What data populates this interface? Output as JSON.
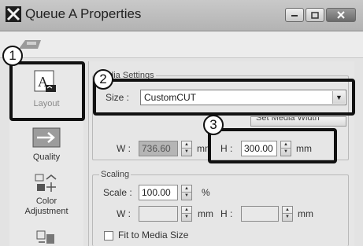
{
  "window": {
    "title": "Queue A Properties",
    "icons": {
      "app": "queue-app-icon",
      "minimize": "minimize-icon",
      "maximize": "maximize-icon",
      "close": "close-icon"
    }
  },
  "callouts": {
    "one": "1",
    "two": "2",
    "three": "3"
  },
  "sidebar": {
    "items": [
      {
        "label": "Layout",
        "icon": "layout-icon",
        "selected": true
      },
      {
        "label": "Quality",
        "icon": "quality-icon"
      },
      {
        "label": "Color Adjustment",
        "line1": "Color",
        "line2": "Adjustment",
        "icon": "color-adjustment-icon"
      },
      {
        "label": "",
        "icon": "filter-icon"
      }
    ]
  },
  "media_settings": {
    "legend_partial": "edia Settings",
    "size_label": "Size :",
    "size_value": "CustomCUT",
    "set_media_button_partial": "Set Media Width",
    "w_label": "W :",
    "w_value": "736.60",
    "w_unit": "mm",
    "h_label": "H :",
    "h_value": "300.00",
    "h_unit": "mm"
  },
  "scaling": {
    "legend": "Scaling",
    "scale_label": "Scale :",
    "scale_value": "100.00",
    "scale_unit": "%",
    "w_label": "W :",
    "w_unit": "mm",
    "h_label": "H :",
    "h_unit": "mm",
    "fit_label": "Fit to Media Size"
  },
  "colors": {
    "callout_border": "#111111",
    "window_bg": "#e6e6e6"
  }
}
